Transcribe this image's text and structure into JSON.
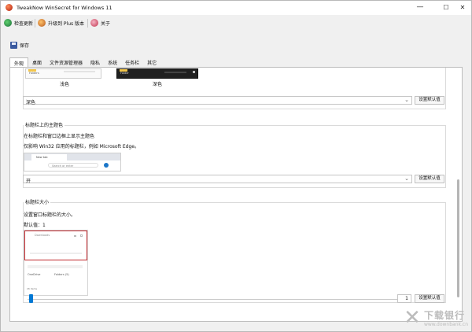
{
  "window": {
    "title": "TweakNow WinSecret for Windows 11",
    "min": "—",
    "max": "☐",
    "close": "✕"
  },
  "toolbar": {
    "check_update": "检查更新",
    "upgrade_plus": "升级到 Plus 版本",
    "about": "关于"
  },
  "save": {
    "label": "保存"
  },
  "tabs": [
    "外观",
    "桌面",
    "文件资源管理器",
    "隐私",
    "系统",
    "任务栏",
    "其它"
  ],
  "theme": {
    "light_label": "浅色",
    "dark_label": "深色",
    "preview_light_text": "Folders",
    "preview_dark_text": "Folder",
    "dropdown_value": "深色",
    "default_btn": "设置默认值"
  },
  "titlebar_color": {
    "heading": "标题栏上的主题色",
    "line1": "在标题栏和窗口边框上显示主题色",
    "line2": "仅影响 Win32 应用的标题栏，例如 Microsoft Edge。",
    "preview_tab": "New tab",
    "preview_search": "Search or enter",
    "dropdown_value": "开",
    "default_btn": "设置默认值"
  },
  "titlebar_size": {
    "heading": "标题栏大小",
    "line1": "设置窗口标题栏的大小。",
    "line2": "默认值：1",
    "preview_title": "Downloads",
    "preview_folder": "OneDrive",
    "preview_folder2": "Folders (5)",
    "preview_items": "26 items",
    "slider_value": "1",
    "slider_fraction": 0.0,
    "default_btn": "设置默认值"
  },
  "watermark": {
    "main": "下载银行",
    "url": "www.downbank.cn"
  },
  "colors": {
    "accent": "#0078d4",
    "red_frame": "#c0282d"
  }
}
